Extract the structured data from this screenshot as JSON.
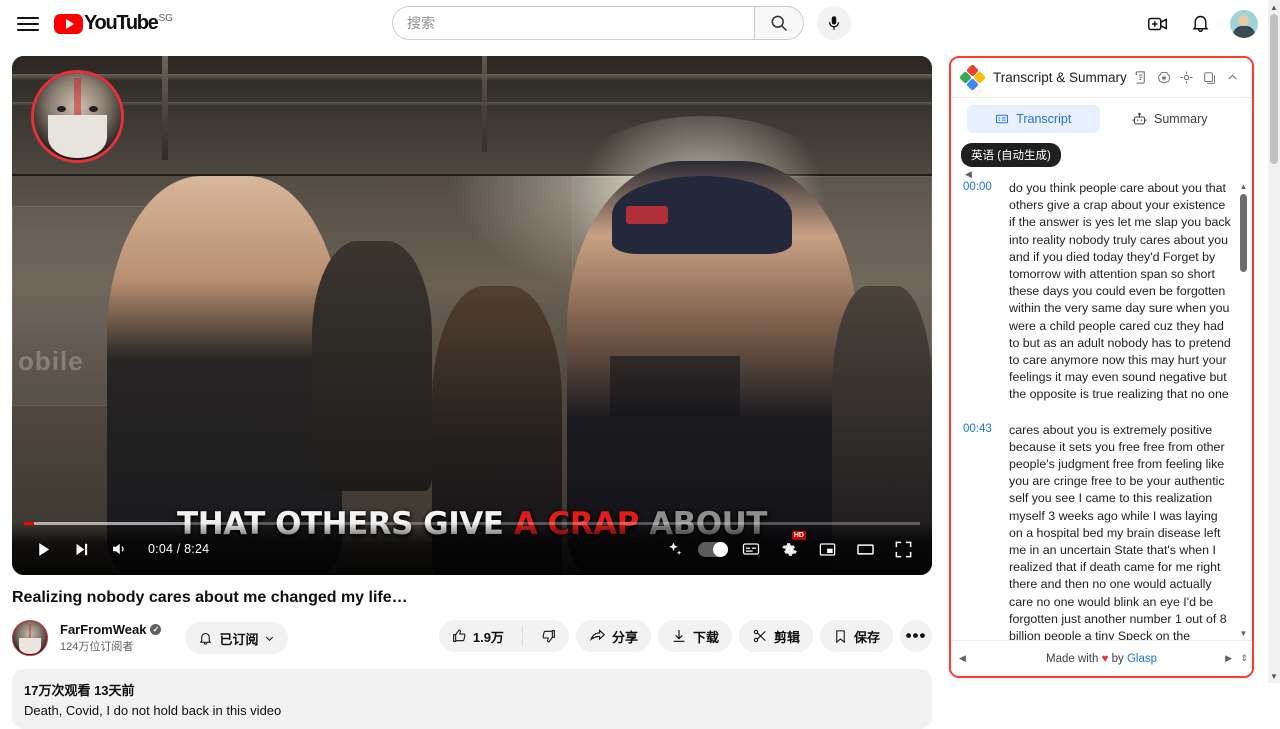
{
  "masthead": {
    "menu_icon": "hamburger-icon",
    "logo_text": "YouTube",
    "country_code": "SG",
    "search": {
      "placeholder": "搜索",
      "search_icon": "search-icon",
      "mic_icon": "microphone-icon"
    },
    "create_icon": "create-video-icon",
    "notifications_icon": "bell-icon",
    "avatar_icon": "account-avatar"
  },
  "player": {
    "caption": {
      "part1": "THAT OTHERS GIVE ",
      "highlight": "A CRAP",
      "part2": " ABOUT"
    },
    "controls": {
      "play_icon": "play-button",
      "next_icon": "next-video-button",
      "volume_icon": "volume-button",
      "time": "0:04 / 8:24",
      "sparkle_icon": "ai-sparkle-button",
      "autoplay_icon": "autoplay-toggle",
      "subtitles_icon": "subtitles-button",
      "settings_icon": "settings-gear-button",
      "settings_badge": "HD",
      "miniplayer_icon": "miniplayer-button",
      "theater_icon": "theater-mode-button",
      "fullscreen_icon": "fullscreen-button"
    },
    "progress_percent": 1.1
  },
  "video": {
    "title": "Realizing nobody cares about me changed my life…",
    "channel": {
      "name": "FarFromWeak",
      "verified_icon": "verified-badge",
      "subscribers": "124万位订阅者"
    },
    "subscribe": {
      "label": "已订阅",
      "bell_icon": "bell-icon",
      "chevron_icon": "chevron-down-icon"
    },
    "actions": {
      "like": {
        "icon": "thumbs-up-icon",
        "count": "1.9万"
      },
      "dislike": {
        "icon": "thumbs-down-icon"
      },
      "share": {
        "icon": "share-icon",
        "label": "分享"
      },
      "download": {
        "icon": "download-icon",
        "label": "下载"
      },
      "clip": {
        "icon": "scissors-icon",
        "label": "剪辑"
      },
      "save": {
        "icon": "bookmark-icon",
        "label": "保存"
      },
      "more": {
        "icon": "more-horizontal-icon",
        "label": "•••"
      }
    },
    "description": {
      "stats": "17万次观看  13天前",
      "snippet": "Death, Covid, I do not hold back in this video"
    }
  },
  "extension": {
    "logo_icon": "glasp-logo",
    "title": "Transcript & Summary",
    "header_icons": [
      {
        "name": "transcript-scroll-icon"
      },
      {
        "name": "openai-icon"
      },
      {
        "name": "claude-sunburst-icon"
      },
      {
        "name": "copy-icon"
      },
      {
        "name": "collapse-chevron-icon"
      }
    ],
    "tabs": [
      {
        "label": "Transcript",
        "icon": "transcript-card-icon",
        "active": true
      },
      {
        "label": "Summary",
        "icon": "robot-icon",
        "active": false
      }
    ],
    "language_chip": "英语 (自动生成)",
    "transcript": [
      {
        "time": "00:00",
        "text": "do you think people care about you that others give a crap about your existence if the answer is yes let me slap you back into reality nobody truly cares about you and if you died today they'd Forget by tomorrow with attention span so short these days you could even be forgotten within the very same day sure when you were a child people cared cuz they had to but as an adult nobody has to pretend to care anymore now this may hurt your feelings it may even sound negative but the opposite is true realizing that no one"
      },
      {
        "time": "00:43",
        "text": "cares about you is extremely positive because it sets you free free from other people's judgment free from feeling like you are cringe free to be your authentic self you see I came to this realization myself 3 weeks ago while I was laying on a hospital bed my brain disease left me in an uncertain State that's when I realized that if death came for me right there and then no one would actually care no one would blink an eye I'd be forgotten just another number 1 out of 8 billion people a tiny Speck on the"
      }
    ],
    "footer": {
      "prefix": "Made with ",
      "heart": "♥",
      "middle": " by ",
      "link": "Glasp"
    },
    "scroll_arrows": {
      "up": "▲",
      "down": "▼",
      "left": "◀",
      "right": "▶"
    }
  },
  "colors": {
    "youtube_red": "#ff0000",
    "link_blue": "#1a73e8",
    "tab_active_bg": "#e8f0fe",
    "highlight_border": "#ff3b30",
    "caption_highlight": "#e01b18"
  }
}
